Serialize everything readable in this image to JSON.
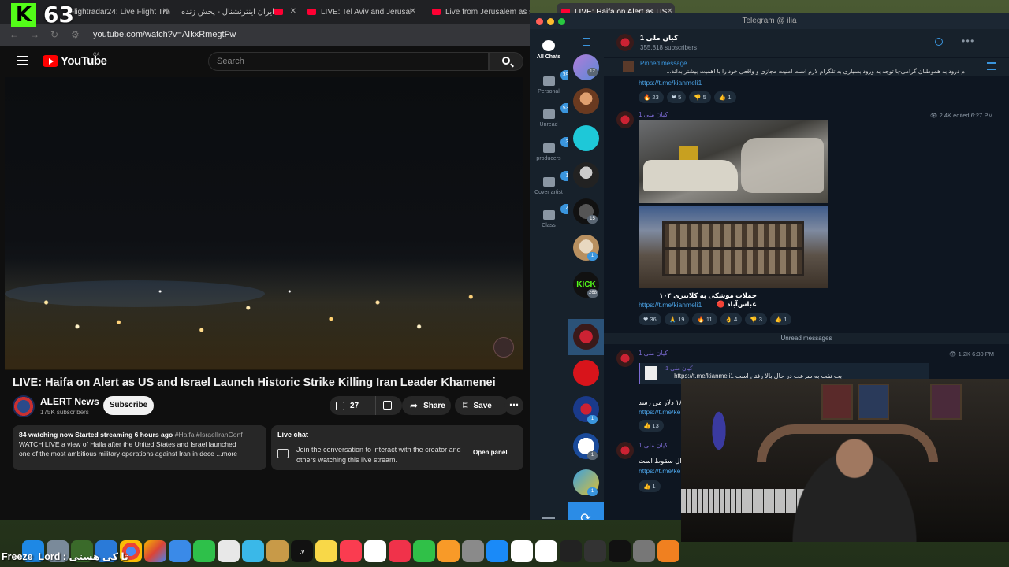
{
  "kick_overlay": {
    "count": "63"
  },
  "browser": {
    "tabs": [
      {
        "label": "Flightradar24: Live Flight Trac"
      },
      {
        "label": "ایران اینترنشنال - پخش زنده"
      },
      {
        "label": "LIVE: Tel Aviv and Jerusal"
      },
      {
        "label": "Live from Jerusalem as si"
      },
      {
        "label": "LIVE: Haifa on Alert as US"
      }
    ],
    "url": "youtube.com/watch?v=AIkxRmegtFw"
  },
  "youtube": {
    "logo_text": "YouTube",
    "country": "CA",
    "search_placeholder": "Search",
    "video_title": "LIVE: Haifa on Alert as US and Israel Launch Historic Strike Killing Iran Leader Khamenei",
    "channel_name": "ALERT News",
    "channel_subs": "175K subscribers",
    "subscribe_label": "Subscribe",
    "like_count": "27",
    "share_label": "Share",
    "save_label": "Save",
    "desc_stats": "84 watching now  Started streaming 6 hours ago",
    "desc_tags": "#Haifa #IsraelIranConf",
    "desc_line1": "WATCH LIVE a view of Haifa after the United States and Israel launched",
    "desc_line2": "one of the most ambitious military operations against Iran in dece ...more",
    "livechat_title": "Live chat",
    "livechat_text": "Join the conversation to interact with the creator and others watching this live stream.",
    "open_panel": "Open panel"
  },
  "telegram": {
    "window_title": "Telegram @ ilia",
    "folders": [
      {
        "label": "All Chats",
        "badge": ""
      },
      {
        "label": "Personal",
        "badge": "395"
      },
      {
        "label": "Unread",
        "badge": "532"
      },
      {
        "label": "producers",
        "badge": "3"
      },
      {
        "label": "Cover artist",
        "badge": "1"
      },
      {
        "label": "Class",
        "badge": "4"
      }
    ],
    "chat_badges": [
      "12",
      "15",
      "1",
      "268",
      "1",
      "1",
      "1"
    ],
    "channel_name": "کیان ملی 1",
    "channel_subs": "355,818 subscribers",
    "pinned_label": "Pinned message",
    "pinned_text": "م درود به هموطنان گرامی-با توجه به ورود بسیاری به تلگرام  لازم است امنیت مجازی و واقعی خود را با اهمیت بیشتر بداند...",
    "pinned_link": "https://t.me/kianmeli1",
    "pinned_reactions": [
      "🔥 23",
      "❤ 5",
      "👎 5",
      "👍 1"
    ],
    "msg1_sender": "کیان ملی 1",
    "msg1_meta": "👁 2.4K edited 6:27 PM",
    "msg1_caption": "حملات موشکی به کلانتری ۱۰۴ عباس‌آباد 🔴",
    "msg1_link": "https://t.me/kianmeli1",
    "msg1_reactions": [
      "❤ 36",
      "🙏 19",
      "🔥 11",
      "👌 4",
      "👎 3",
      "👍 1"
    ],
    "unread_label": "Unread messages",
    "msg2_sender": "کیان ملی 1",
    "msg2_meta": "👁 1.2K 6:30 PM",
    "msg2_reply_name": "کیان ملی 1",
    "msg2_reply_text": "بت نفت به سرعت در حال بالا رفتن است https://t.me/kianmeli1",
    "msg2_text": "۱۸ دلار می رسد",
    "msg2_link": "https://t.me/ke",
    "msg2_reactions": [
      "👍 13"
    ],
    "msg3_sender": "کیان ملی 1",
    "msg3_text": "ال سقوط است",
    "msg3_link": "https://t.me/ke",
    "msg3_reactions": [
      "👍 1"
    ]
  },
  "overlay": {
    "freeze_lord": "Freeze_Lord : تا کی هستی"
  },
  "colors": {
    "kick_green": "#53fc18",
    "youtube_red": "#ff0000",
    "telegram_blue": "#2b8ce6",
    "telegram_bg": "#0e1621"
  }
}
